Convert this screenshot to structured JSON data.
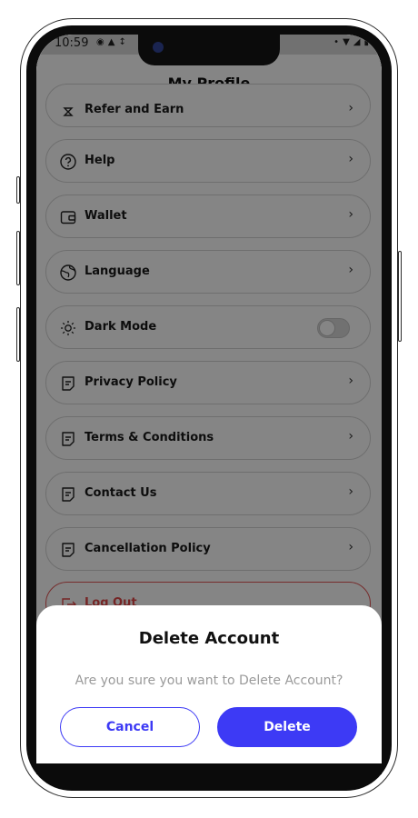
{
  "status_bar": {
    "time": "10:59",
    "icons_left": [
      "app-icon",
      "notification-icon",
      "data-speed-icon"
    ],
    "icons_right": [
      "bluetooth-icon",
      "wifi-icon",
      "signal-icon",
      "battery-icon"
    ]
  },
  "page": {
    "title": "My Profile"
  },
  "menu": {
    "items": [
      {
        "id": "refer",
        "label": "Refer and Earn",
        "icon": "gift-icon",
        "type": "chevron"
      },
      {
        "id": "help",
        "label": "Help",
        "icon": "help-circle-icon",
        "type": "chevron"
      },
      {
        "id": "wallet",
        "label": "Wallet",
        "icon": "wallet-icon",
        "type": "chevron"
      },
      {
        "id": "language",
        "label": "Language",
        "icon": "globe-icon",
        "type": "chevron"
      },
      {
        "id": "dark-mode",
        "label": "Dark Mode",
        "icon": "sun-icon",
        "type": "toggle",
        "toggle_on": false
      },
      {
        "id": "privacy",
        "label": "Privacy Policy",
        "icon": "document-icon",
        "type": "chevron"
      },
      {
        "id": "terms",
        "label": "Terms & Conditions",
        "icon": "document-icon",
        "type": "chevron"
      },
      {
        "id": "contact",
        "label": "Contact Us",
        "icon": "document-icon",
        "type": "chevron"
      },
      {
        "id": "cancellation",
        "label": "Cancellation  Policy",
        "icon": "document-icon",
        "type": "chevron"
      },
      {
        "id": "logout",
        "label": "Log Out",
        "icon": "logout-icon",
        "type": "none"
      }
    ]
  },
  "dialog": {
    "title": "Delete Account",
    "message": "Are you sure you want to Delete Account?",
    "cancel_label": "Cancel",
    "delete_label": "Delete"
  },
  "colors": {
    "accent": "#3d3af5",
    "danger": "#e04848",
    "overlay": "#000000"
  }
}
